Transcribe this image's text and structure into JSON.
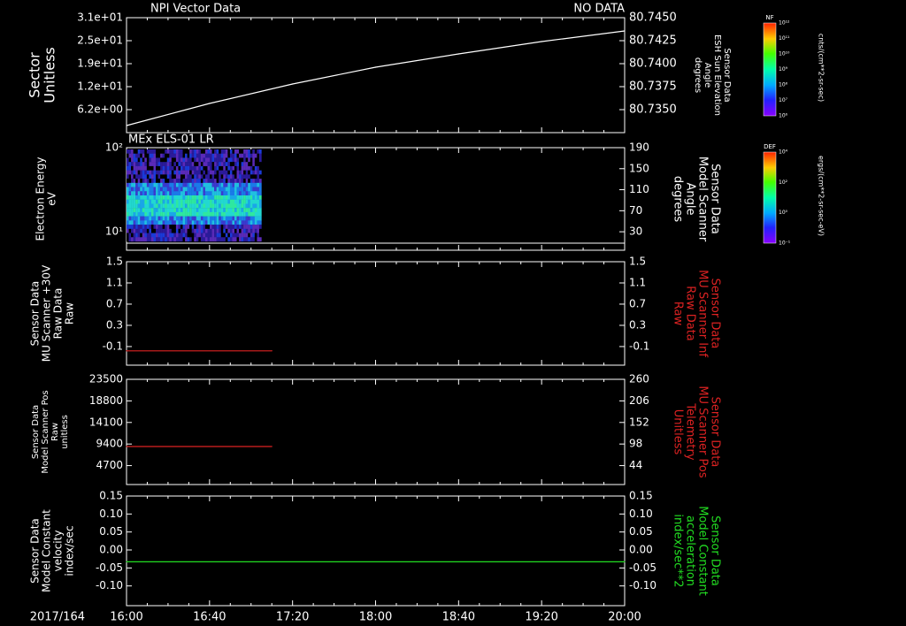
{
  "colors": {
    "background": "#000000",
    "foreground": "#ffffff",
    "red_series": "#dd2222",
    "green_series": "#22dd22"
  },
  "header": {
    "left_title": "NPI Vector Data",
    "right_status": "NO DATA"
  },
  "x_axis": {
    "date_label": "2017/164",
    "tick_labels": [
      "16:00",
      "16:40",
      "17:20",
      "18:00",
      "18:40",
      "19:20",
      "20:00"
    ]
  },
  "chart_data": [
    {
      "type": "line",
      "title": "NPI Vector Data",
      "status": "NO DATA",
      "ylabel_left": [
        "Sector",
        "Unitless"
      ],
      "ylabel_right": [
        "Sensor Data",
        "ESH Sun Elevation",
        "Angle",
        "degrees"
      ],
      "yticks_left": [
        "3.1e+01",
        "2.5e+01",
        "1.9e+01",
        "1.2e+01",
        "6.2e+00"
      ],
      "yticks_right": [
        "80.7450",
        "80.7425",
        "80.7400",
        "80.7375",
        "80.7350"
      ],
      "ylim_right": [
        80.733,
        80.746
      ],
      "series": [
        {
          "color": "#ffffff",
          "x": [
            "16:00",
            "16:40",
            "17:20",
            "18:00",
            "18:40",
            "19:20",
            "20:00"
          ],
          "y": [
            80.7338,
            80.7363,
            80.7385,
            80.7404,
            80.7419,
            80.7433,
            80.7445
          ]
        }
      ],
      "colorbar": {
        "title": "NF",
        "unit": "cnts/(cm**2-sr-sec)",
        "tick_labels": [
          "10¹²",
          "10¹¹",
          "10¹⁰",
          "10⁹",
          "10⁸",
          "10⁷",
          "10⁶"
        ]
      }
    },
    {
      "type": "heatmap",
      "title": "MEx ELS-01 LR",
      "ylabel_left": [
        "Electron Energy",
        "eV"
      ],
      "ylabel_right": [
        "Sensor Data",
        "Model Scanner",
        "Angle",
        "degrees"
      ],
      "yticks_left": [
        "10²",
        "10¹"
      ],
      "yticks_right": [
        "190",
        "150",
        "110",
        "70",
        "30"
      ],
      "x_coverage": [
        "16:00",
        "17:05"
      ],
      "colorbar": {
        "title": "DEF",
        "unit": "ergs/(cm**2-sr-sec-eV)",
        "tick_labels": [
          "10⁴",
          "10²",
          "10⁰",
          "10⁻¹"
        ]
      }
    },
    {
      "type": "line",
      "ylabel_left": [
        "Sensor Data",
        "MU Scanner +30V",
        "Raw Data",
        "Raw"
      ],
      "ylabel_right": [
        "Sensor Data",
        "MU Scanner Inf",
        "Raw Data",
        "Raw"
      ],
      "yticks_left": [
        "1.5",
        "1.1",
        "0.7",
        "0.3",
        "-0.1"
      ],
      "yticks_right": [
        "1.5",
        "1.1",
        "0.7",
        "0.3",
        "-0.1"
      ],
      "ylim": [
        -0.3,
        1.5
      ],
      "series": [
        {
          "color": "#dd2222",
          "x": [
            "16:00",
            "17:10"
          ],
          "y": [
            -0.05,
            -0.05
          ]
        }
      ]
    },
    {
      "type": "line",
      "ylabel_left": [
        "Sensor Data",
        "Model Scanner Pos",
        "Raw",
        "unitless"
      ],
      "ylabel_right": [
        "Sensor Data",
        "MU Scanner Pos",
        "Telemetry",
        "Unitless"
      ],
      "yticks_left": [
        "23500",
        "18800",
        "14100",
        "9400",
        "4700"
      ],
      "yticks_right": [
        "260",
        "206",
        "152",
        "98",
        "44"
      ],
      "ylim": [
        0,
        23500
      ],
      "series": [
        {
          "color": "#dd2222",
          "x": [
            "16:00",
            "17:10"
          ],
          "y": [
            8500,
            8500
          ]
        }
      ]
    },
    {
      "type": "line",
      "ylabel_left": [
        "Sensor Data",
        "Model Constant",
        "velocity",
        "index/sec"
      ],
      "ylabel_right": [
        "Sensor Data",
        "Model Constant",
        "acceleration",
        "index/sec**2"
      ],
      "yticks_left": [
        "0.15",
        "0.10",
        "0.05",
        "0.00",
        "-0.05",
        "-0.10"
      ],
      "yticks_right": [
        "0.15",
        "0.10",
        "0.05",
        "0.00",
        "-0.05",
        "-0.10"
      ],
      "ylim": [
        -0.1,
        0.15
      ],
      "series": [
        {
          "color": "#22dd22",
          "x": [
            "16:00",
            "20:00"
          ],
          "y": [
            0.0,
            0.0
          ]
        }
      ]
    }
  ]
}
